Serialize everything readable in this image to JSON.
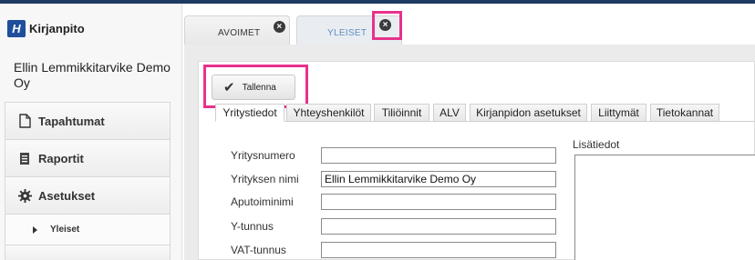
{
  "app": {
    "logo_text": "Kirjanpito",
    "logo_mark": "H",
    "company_name": "Ellin Lemmikkitarvike Demo Oy"
  },
  "sidebar": {
    "items": [
      {
        "label": "Tapahtumat",
        "icon": "document-icon"
      },
      {
        "label": "Raportit",
        "icon": "report-icon"
      },
      {
        "label": "Asetukset",
        "icon": "gear-icon"
      }
    ],
    "sub_items": [
      {
        "label": "Yleiset",
        "icon": "caret-right-icon"
      }
    ]
  },
  "top_tabs": [
    {
      "label": "AVOIMET",
      "close": "×"
    },
    {
      "label": "YLEISET",
      "close": "×"
    }
  ],
  "toolbar": {
    "save_label": "Tallenna",
    "save_icon": "✔"
  },
  "sub_tabs": [
    "Yritystiedot",
    "Yhteyshenkilöt",
    "Tiliöinnit",
    "ALV",
    "Kirjanpidon asetukset",
    "Liittymät",
    "Tietokannat"
  ],
  "form": {
    "fields": [
      {
        "label": "Yritysnumero",
        "value": ""
      },
      {
        "label": "Yrityksen nimi",
        "value": "Ellin Lemmikkitarvike Demo Oy"
      },
      {
        "label": "Aputoiminimi",
        "value": ""
      },
      {
        "label": "Y-tunnus",
        "value": ""
      },
      {
        "label": "VAT-tunnus",
        "value": ""
      }
    ],
    "notes_label": "Lisätiedot",
    "notes_value": ""
  },
  "colors": {
    "highlight": "#e6328c",
    "brand": "#1f4e9c",
    "active_tab_text": "#5d8ec2"
  }
}
